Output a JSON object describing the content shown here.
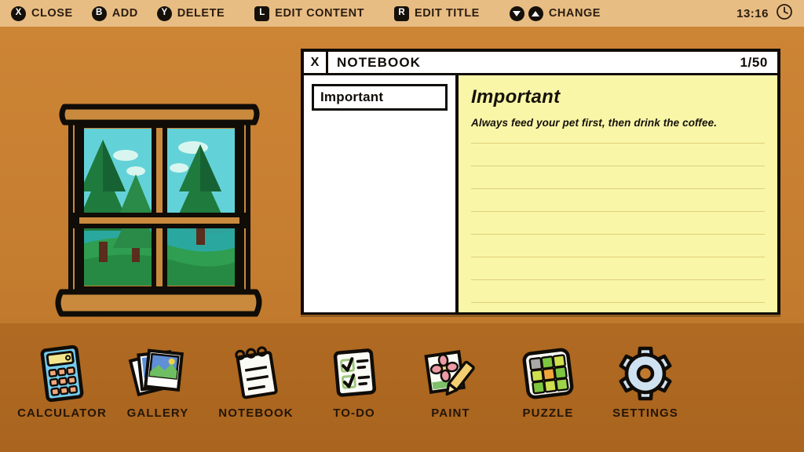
{
  "hud": {
    "actions": [
      {
        "glyph": "X",
        "shape": "round",
        "label": "CLOSE",
        "name": "close"
      },
      {
        "glyph": "B",
        "shape": "round",
        "label": "ADD",
        "name": "add"
      },
      {
        "glyph": "Y",
        "shape": "round",
        "label": "DELETE",
        "name": "delete"
      },
      {
        "glyph": "L",
        "shape": "sq",
        "label": "EDIT CONTENT",
        "name": "edit-content"
      },
      {
        "glyph": "R",
        "shape": "sq",
        "label": "EDIT TITLE",
        "name": "edit-title"
      }
    ],
    "change": {
      "label": "CHANGE",
      "down_icon": "triangle-down-icon",
      "up_icon": "triangle-up-icon"
    },
    "time": "13:16",
    "clock_icon": "clock-icon",
    "bar_color": "#e8bd83",
    "text_color": "#2b1d11"
  },
  "notebook": {
    "close_label": "X",
    "title": "NOTEBOOK",
    "page_counter": "1/50",
    "entries": [
      {
        "label": "Important",
        "selected": true
      }
    ],
    "page": {
      "title": "Important",
      "lines": [
        "Always feed your pet first, then drink the coffee."
      ],
      "ruled_line_count": 8,
      "paper_color": "#f9f6a8",
      "rule_color": "#ded07a"
    }
  },
  "scene": {
    "wall_color": "#c87f31",
    "floor_color": "#ab651f",
    "window_illustration": {
      "name": "window-view-illustration",
      "frame_color": "#c98a3e",
      "sky_color": "#63d2d8",
      "water_color": "#2fa39b",
      "grass_color": "#2f9e50",
      "tree_color": "#1f7a3e"
    }
  },
  "dock": {
    "items": [
      {
        "label": "CALCULATOR",
        "icon": "calculator-icon"
      },
      {
        "label": "GALLERY",
        "icon": "gallery-icon"
      },
      {
        "label": "NOTEBOOK",
        "icon": "notebook-icon"
      },
      {
        "label": "TO-DO",
        "icon": "todo-icon"
      },
      {
        "label": "PAINT",
        "icon": "paint-icon"
      },
      {
        "label": "PUZZLE",
        "icon": "puzzle-icon"
      },
      {
        "label": "SETTINGS",
        "icon": "settings-gear-icon"
      }
    ]
  }
}
